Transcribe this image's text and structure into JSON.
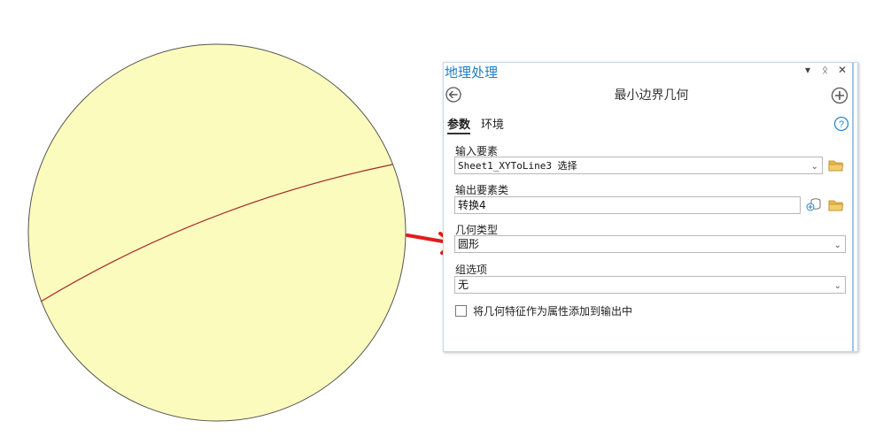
{
  "gp_pane": {
    "title": "地理处理",
    "controls": {
      "menu": "▾",
      "pin": "ᛟ",
      "close": "✕"
    },
    "tool_title": "最小边界几何",
    "tabs": [
      {
        "label": "参数",
        "active": true
      },
      {
        "label": "环境",
        "active": false
      }
    ],
    "params": {
      "input_features": {
        "label": "输入要素",
        "value": "Sheet1_XYToLine3 选择"
      },
      "output_features": {
        "label": "输出要素类",
        "value": "转换4"
      },
      "geometry_type": {
        "label": "几何类型",
        "value": "圆形"
      },
      "group_option": {
        "label": "组选项",
        "value": "无"
      },
      "add_attributes": {
        "label": "将几何特征作为属性添加到输出中",
        "checked": false
      }
    }
  },
  "colors": {
    "circle_fill": "#fbfbbd",
    "circle_stroke": "#555555",
    "line_color": "#a52a2a",
    "arrow_color": "#e31b1b",
    "title_blue": "#1f7fc5",
    "folder_yellow": "#e8b84a"
  },
  "icons": {
    "back": "back-arrow-icon",
    "add": "plus-circle-icon",
    "help": "help-icon",
    "folder": "folder-icon",
    "new_dataset": "new-dataset-icon"
  }
}
